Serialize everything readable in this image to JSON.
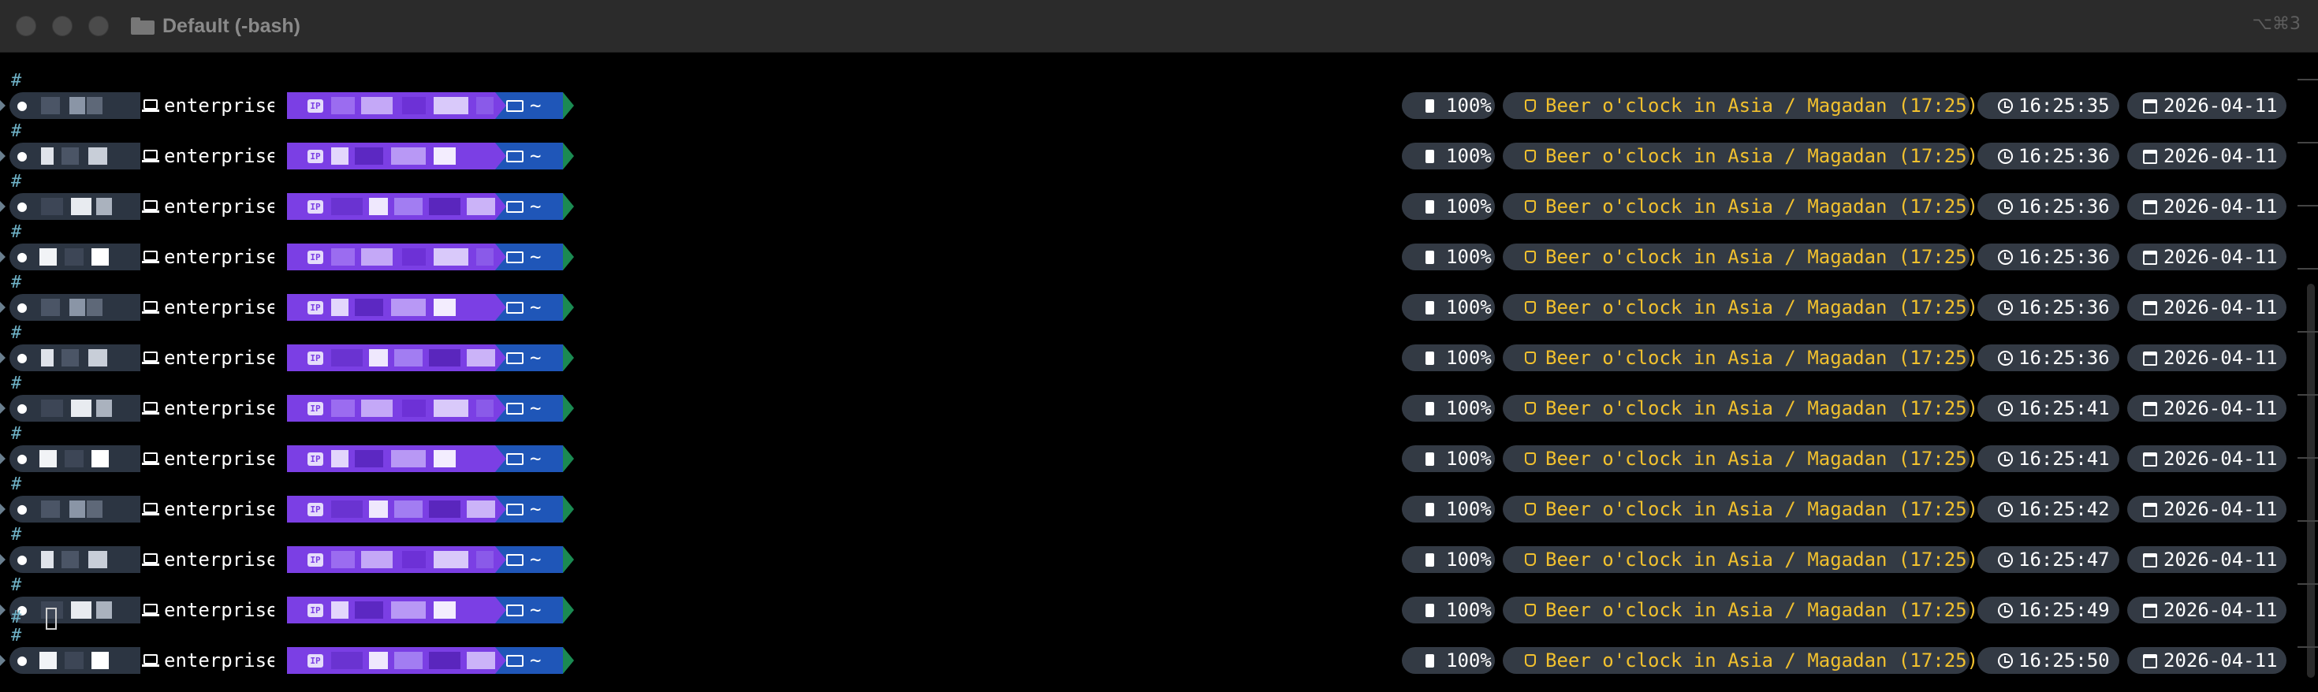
{
  "window": {
    "title": "Default (-bash)",
    "shortcut": "⌥⌘3"
  },
  "prompt": {
    "marker": "#",
    "host": "enterprise",
    "ip_badge": "IP",
    "directory": "~",
    "battery": "100%",
    "beer_message": "Beer o'clock in Asia / Magadan (17:25)",
    "date": "2026-04-11"
  },
  "rows": [
    {
      "time": "16:25:35"
    },
    {
      "time": "16:25:36"
    },
    {
      "time": "16:25:36"
    },
    {
      "time": "16:25:36"
    },
    {
      "time": "16:25:36"
    },
    {
      "time": "16:25:36"
    },
    {
      "time": "16:25:41"
    },
    {
      "time": "16:25:41"
    },
    {
      "time": "16:25:42"
    },
    {
      "time": "16:25:47"
    },
    {
      "time": "16:25:49"
    },
    {
      "time": "16:25:50"
    }
  ],
  "colors": {
    "apple_segment": "#2c3542",
    "ip_segment": "#7b3fe4",
    "dir_segment": "#1f56b8",
    "end_segment": "#1b8a52",
    "right_segment": "#333a44",
    "beer_text": "#f2c12e",
    "hash": "#6fb3c8"
  },
  "icons": {
    "apple": "apple-icon",
    "host": "laptop-icon",
    "dir": "folder-open-icon",
    "battery": "battery-icon",
    "beer": "beer-icon",
    "clock": "clock-icon",
    "date": "calendar-icon"
  }
}
